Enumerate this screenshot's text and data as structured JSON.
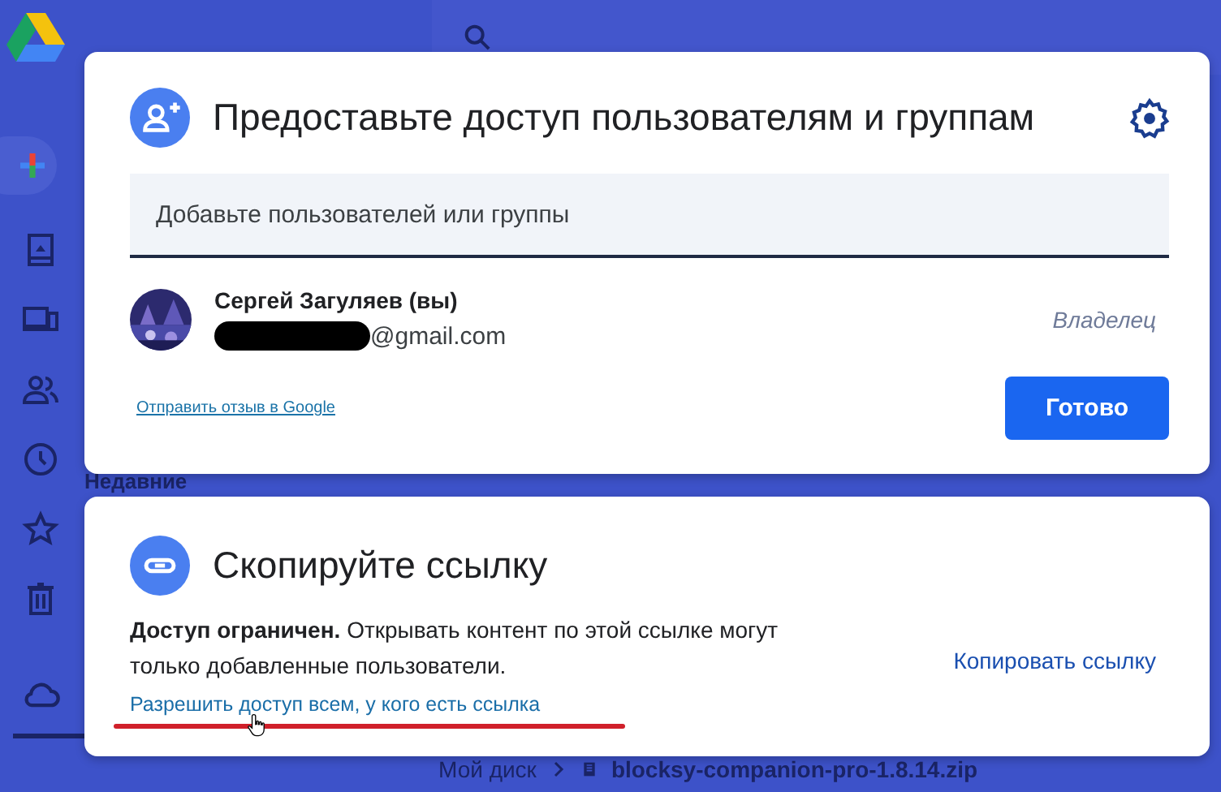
{
  "app": {
    "section": "Недавние",
    "breadcrumb": "Мой диск",
    "file_name": "blocksy-companion-pro-1.8.14.zip"
  },
  "share_dialog": {
    "title": "Предоставьте доступ пользователям и группам",
    "field": {
      "placeholder": "Добавьте пользователей или группы"
    },
    "people": [
      {
        "name": "Сергей Загуляев (вы)",
        "email": "@gmail.com",
        "email_redacted": true,
        "role": "Владелец"
      }
    ],
    "feedback_link": "Отправить отзыв в Google",
    "done_button": "Готово"
  },
  "link_dialog": {
    "title": "Скопируйте ссылку",
    "description": "**Доступ ограничен.** Открывать контент по этой ссылке могут только добавленные пользователи.",
    "change_link": "Разрешить доступ всем, у кого есть ссылка",
    "copy_button": "Копировать ссылку"
  }
}
